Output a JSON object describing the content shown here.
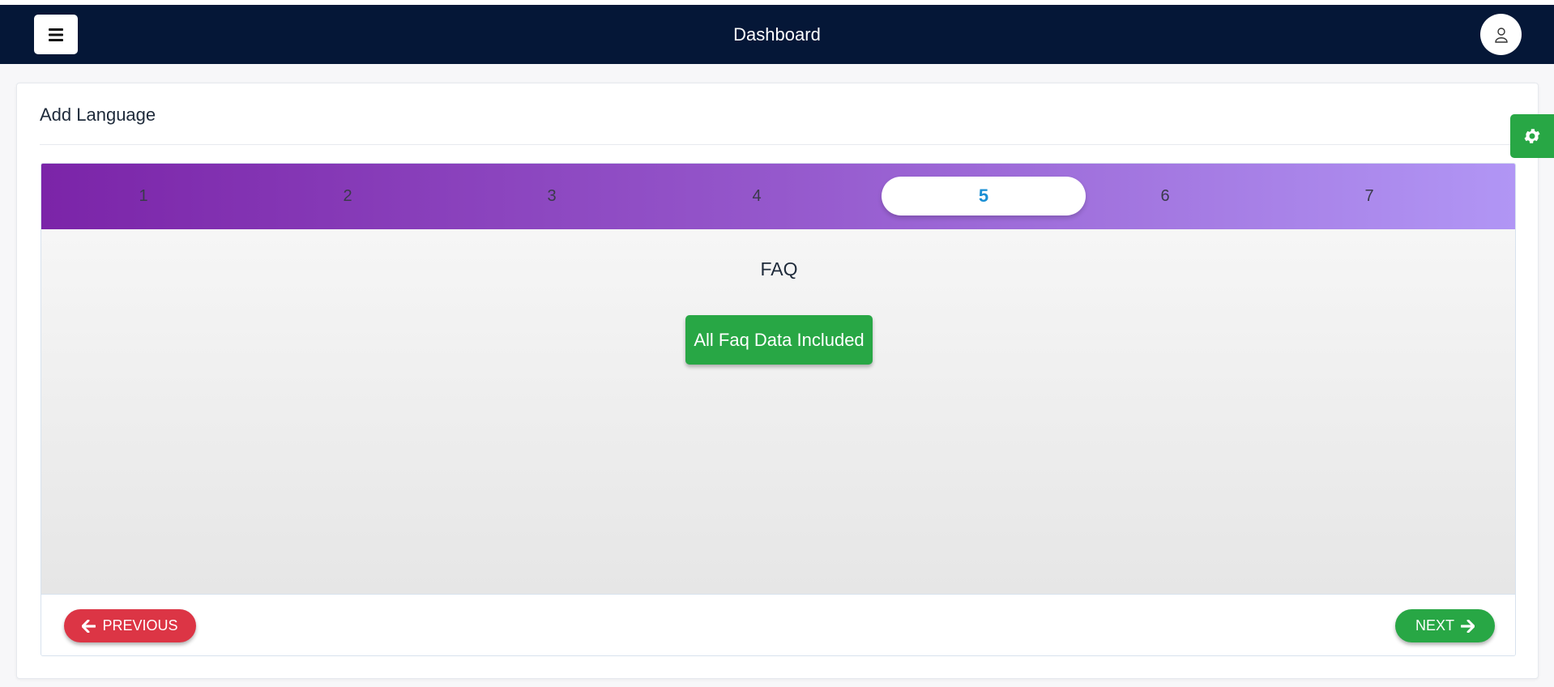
{
  "navbar": {
    "title": "Dashboard",
    "menu_icon": "hamburger-icon",
    "user_icon": "user-icon",
    "background": "#051737"
  },
  "settings": {
    "icon": "gear-icon",
    "color": "#28a745"
  },
  "card": {
    "title": "Add Language"
  },
  "wizard": {
    "steps": [
      {
        "label": "1"
      },
      {
        "label": "2"
      },
      {
        "label": "3"
      },
      {
        "label": "4"
      },
      {
        "label": "5"
      },
      {
        "label": "6"
      },
      {
        "label": "7"
      }
    ],
    "active_step": "5",
    "panel_heading": "FAQ",
    "included_button": "All Faq Data Included",
    "previous_label": "PREVIOUS",
    "next_label": "NEXT"
  },
  "colors": {
    "accent_green": "#28a745",
    "danger_red": "#dc3545",
    "active_step_text": "#1a8fd4",
    "gradient_start": "#7b24a8",
    "gradient_end": "#b196f5"
  }
}
